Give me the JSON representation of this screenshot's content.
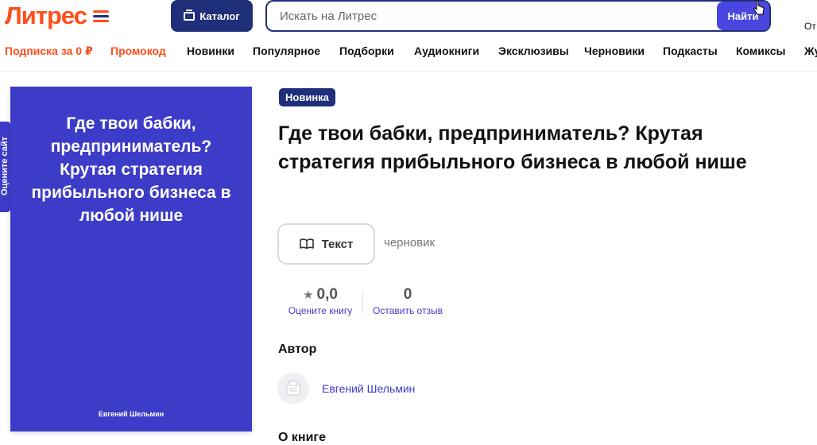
{
  "header": {
    "logo_text": "Литрес",
    "logo_colors": [
      "#ff4e1a",
      "#1f2f7a",
      "#ff4e1a"
    ],
    "catalog_label": "Каталог",
    "search_placeholder": "Искать на Литрес",
    "search_button": "Найти",
    "right_truncated": "От"
  },
  "nav": {
    "items": [
      {
        "label": "Подписка за 0 ₽",
        "promo": true
      },
      {
        "label": "Промокод",
        "promo": true
      },
      {
        "label": "Новинки",
        "promo": false
      },
      {
        "label": "Популярное",
        "promo": false
      },
      {
        "label": "Подборки",
        "promo": false
      },
      {
        "label": "Аудиокниги",
        "promo": false
      },
      {
        "label": "Эксклюзивы",
        "promo": false
      },
      {
        "label": "Черновики",
        "promo": false
      },
      {
        "label": "Подкасты",
        "promo": false
      },
      {
        "label": "Комиксы",
        "promo": false
      },
      {
        "label": "Жу",
        "promo": false
      }
    ]
  },
  "side_tab": {
    "label": "Оцените сайт"
  },
  "book": {
    "badge": "Новинка",
    "title": "Где твои бабки, предприниматель? Крутая стратегия прибыльного бизнеса в любой нише",
    "cover_title": "Где твои бабки, предприниматель? Крутая стратегия прибыльного бизнеса в любой нише",
    "cover_author": "Евгений Шельмин",
    "cover_color": "#3d3cc9",
    "format_label": "Текст",
    "status": "черновик",
    "rating_value": "0,0",
    "rate_link": "Оцените книгу",
    "reviews_count": "0",
    "review_link": "Оставить отзыв"
  },
  "author_section": {
    "heading": "Автор",
    "name": "Евгений Шельмин"
  },
  "about_section": {
    "heading": "О книге"
  },
  "colors": {
    "brand_orange": "#ff4e1a",
    "brand_navy": "#1f2f7a",
    "link_blue": "#3d3cc9"
  }
}
